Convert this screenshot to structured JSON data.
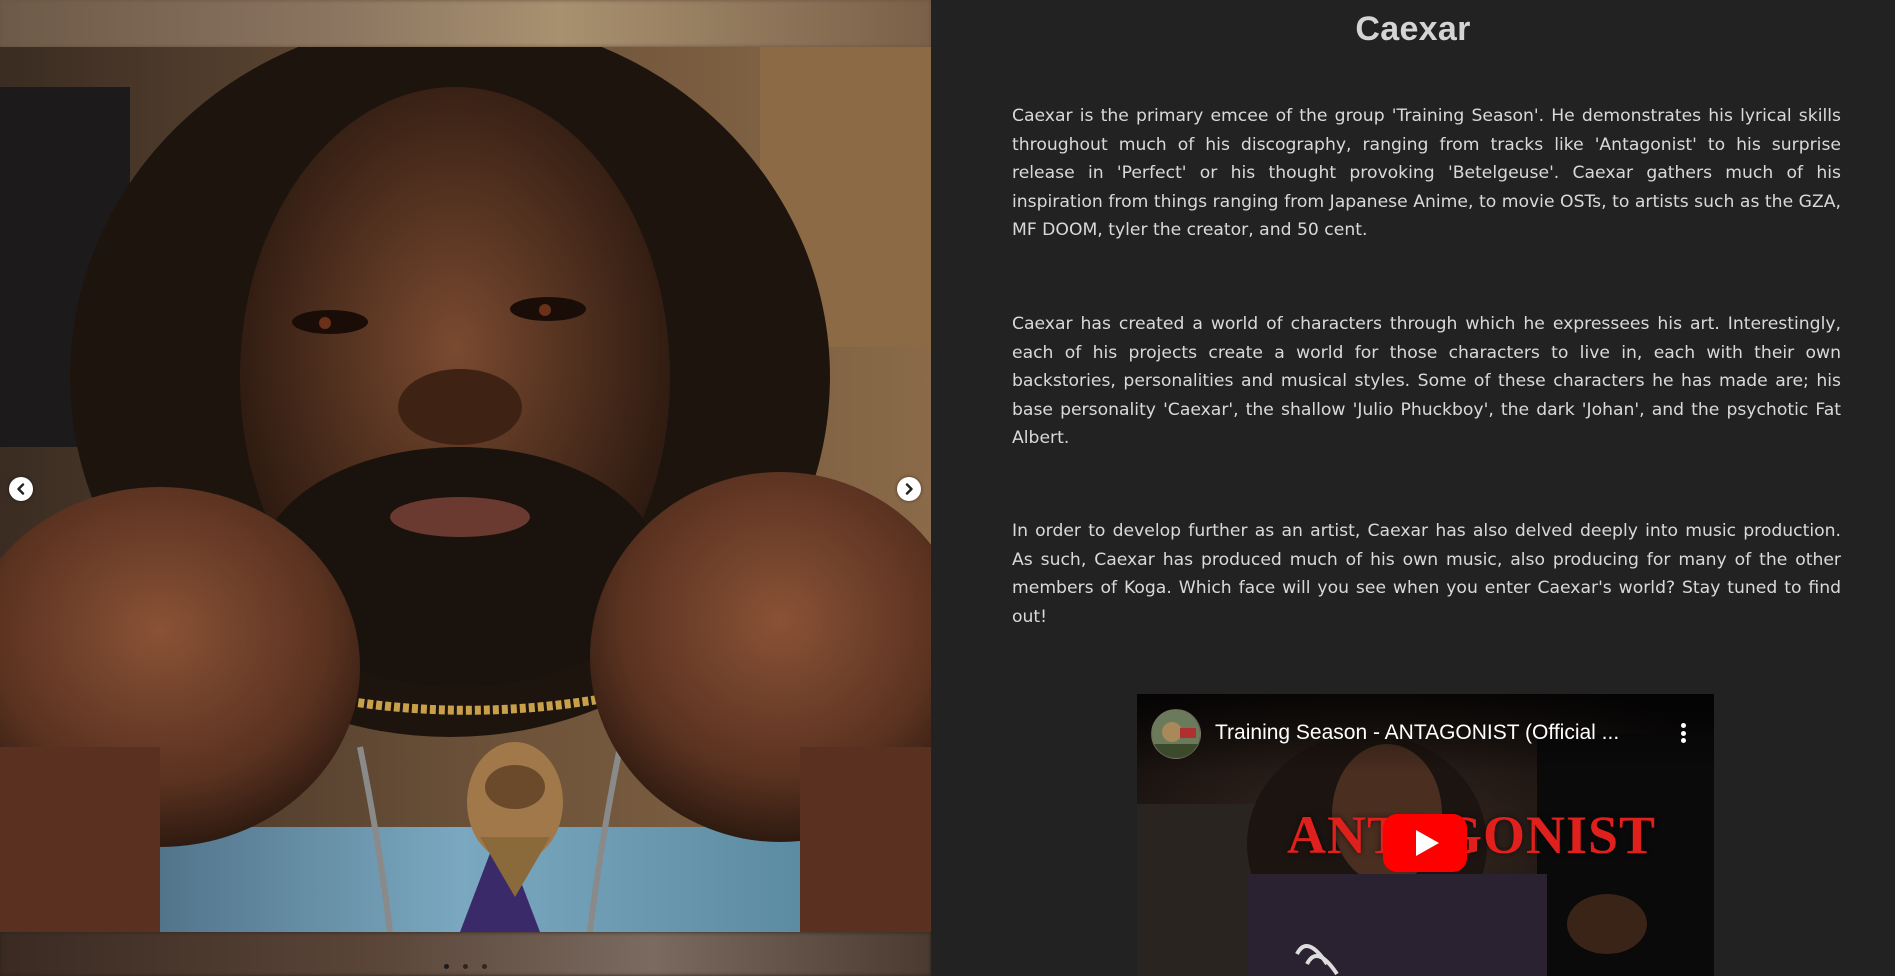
{
  "carousel": {
    "image_alt": "Portrait of Caexar holding a gold chain with a pendant",
    "slide_count": 3,
    "active_slide": 1
  },
  "artist": {
    "name": "Caexar",
    "paragraphs": [
      "Caexar is the primary emcee of the group 'Training Season'. He demonstrates his lyrical skills throughout much of his discography, ranging from tracks like 'Antagonist' to his surprise release in 'Perfect' or his thought provoking 'Betelgeuse'. Caexar gathers much of his inspiration from things ranging from Japanese Anime, to movie OSTs, to artists such as the GZA, MF DOOM, tyler the creator, and 50 cent.",
      "Caexar has created a world of characters through which he expressees his art. Interestingly, each of his projects create a world for those characters to live in, each with their own backstories, personalities and musical styles. Some of these characters he has made are; his base personality 'Caexar', the shallow 'Julio Phuckboy', the dark 'Johan', and the psychotic Fat Albert.",
      "In order to develop further as an artist, Caexar has also delved deeply into music production. As such, Caexar has produced much of his own music, also producing for many of the other members of Koga. Which face will you see when you enter Caexar's world? Stay tuned to find out!"
    ]
  },
  "video": {
    "title": "Training Season - ANTAGONIST (Official ...",
    "headline": "ANTAGONIST"
  },
  "icons": {
    "prev": "chevron-left-icon",
    "next": "chevron-right-icon",
    "play": "youtube-play-icon",
    "more": "more-vertical-icon"
  },
  "colors": {
    "background": "#222222",
    "text": "#d9d9d9",
    "title": "#d4d4d4",
    "play_red": "#ff0000",
    "headline_red": "#e0201c"
  }
}
